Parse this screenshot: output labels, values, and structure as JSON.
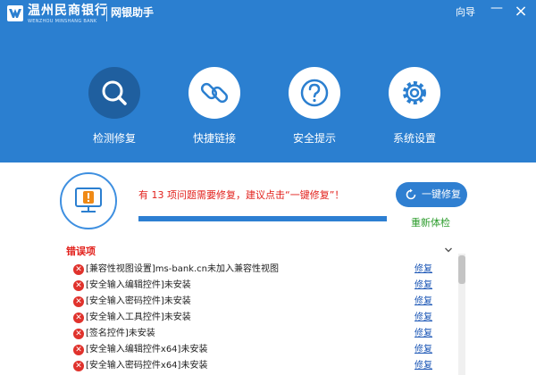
{
  "titlebar": {
    "brand_cn": "温州民商银行",
    "brand_en": "WENZHOU MINSHANG BANK",
    "app_name": "网银助手",
    "guide_label": "向导",
    "minimize_label": "—",
    "close_label": "×"
  },
  "nav": [
    {
      "label": "检测修复",
      "icon": "search-icon",
      "active": true
    },
    {
      "label": "快捷链接",
      "icon": "link-icon",
      "active": false
    },
    {
      "label": "安全提示",
      "icon": "question-icon",
      "active": false
    },
    {
      "label": "系统设置",
      "icon": "gear-icon",
      "active": false
    }
  ],
  "status": {
    "message": "有 13 项问题需要修复，建议点击“一键修复”！",
    "progress_percent": 100,
    "fix_all_label": "一键修复",
    "recheck_label": "重新体检"
  },
  "errors": {
    "section_title": "错误项",
    "items": [
      {
        "text": "[兼容性视图设置]ms-bank.cn未加入兼容性视图",
        "action": "修复"
      },
      {
        "text": "[安全输入编辑控件]未安装",
        "action": "修复"
      },
      {
        "text": "[安全输入密码控件]未安装",
        "action": "修复"
      },
      {
        "text": "[安全输入工具控件]未安装",
        "action": "修复"
      },
      {
        "text": "[签名控件]未安装",
        "action": "修复"
      },
      {
        "text": "[安全输入编辑控件x64]未安装",
        "action": "修复"
      },
      {
        "text": "[安全输入密码控件x64]未安装",
        "action": "修复"
      }
    ]
  },
  "colors": {
    "header_blue": "#2b7fd0",
    "active_nav": "#1f5f9f",
    "error_red": "#e2211c",
    "recheck_green": "#2d9c2d",
    "link_blue": "#1a55b5"
  }
}
